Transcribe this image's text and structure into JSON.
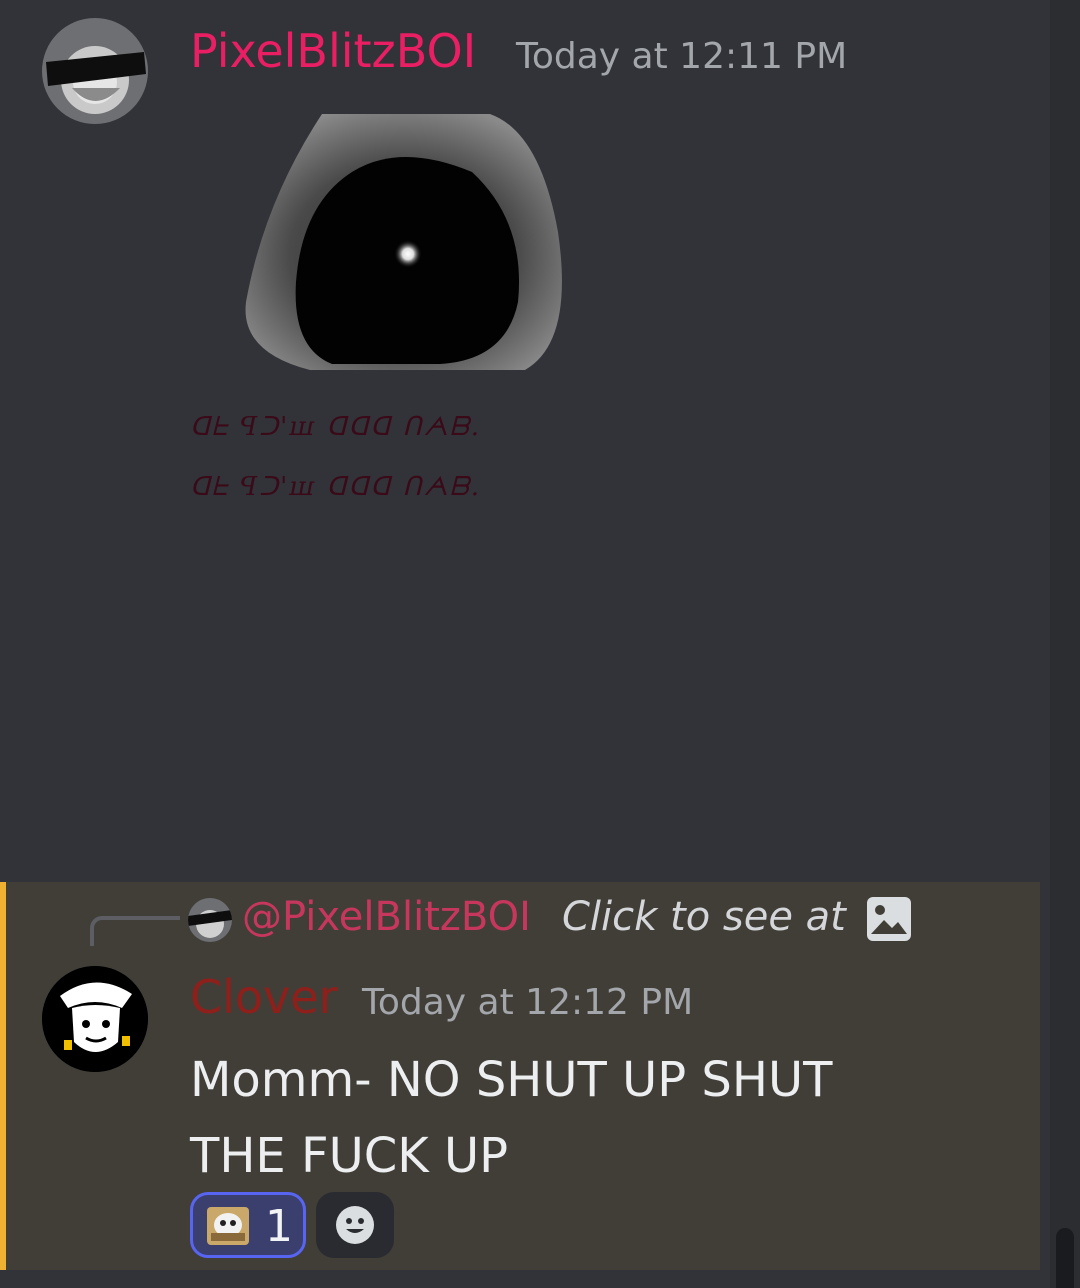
{
  "messages": [
    {
      "username": "PixelBlitzBOI",
      "timestamp": "Today at 12:11 PM",
      "cipher_lines": [
        "ᗡᖶ ꟼᑐ'ꟺ ꓷᗡꓷ ᑎᗅᗷ.",
        "ᗡᖶ ꟼᑐ'ꟺ ꓷᗡꓷ ᑎᗅᗷ."
      ],
      "username_color": "#e91e63"
    },
    {
      "reply": {
        "mention": "@PixelBlitzBOI",
        "preview": "Click to see at"
      },
      "username": "Clover",
      "timestamp": "Today at 12:12 PM",
      "content_line1": "Momm- NO SHUT UP SHUT",
      "content_line2": "THE FUCK UP",
      "reaction_count": "1",
      "username_color": "#8e1f1a",
      "highlight_color": "#f0b132"
    }
  ]
}
